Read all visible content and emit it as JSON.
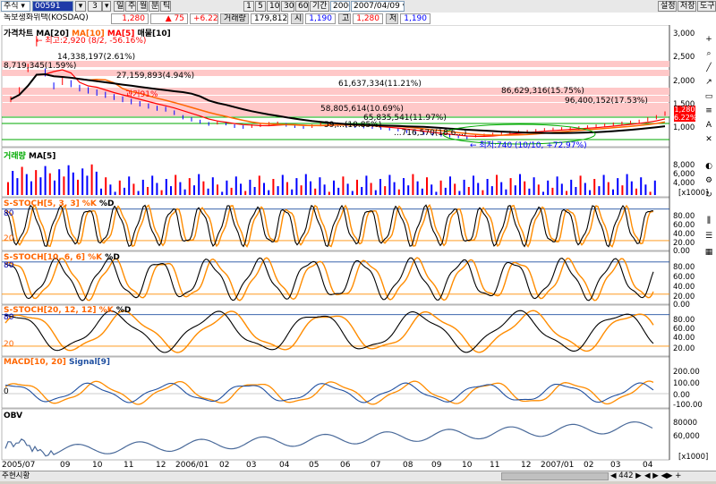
{
  "toolbar": {
    "market": "주식",
    "code": "00591",
    "num": "3",
    "period_tabs": [
      "일",
      "주",
      "월",
      "분",
      "틱"
    ],
    "interval_buttons": [
      "1",
      "5",
      "10",
      "30",
      "60"
    ],
    "period_label": "기간",
    "period_count": "2000",
    "date": "2007/04/09",
    "right_buttons": [
      "설정",
      "저장",
      "도구"
    ]
  },
  "quote": {
    "name": "녹보생화위택(KOSDAQ)",
    "price": "1,280",
    "change_arrow": "▲",
    "change": "75",
    "change_pct": "+6.22",
    "volume_label": "거래량",
    "volume": "179,812",
    "open_label": "시",
    "open": "1,190",
    "high_label": "고",
    "high": "1,280",
    "low_label": "저",
    "low": "1,190"
  },
  "price_panel": {
    "title": "가격차트",
    "ma_legend": [
      "MA[20]",
      "MA[10]",
      "MA[5]",
      "매물[10]"
    ],
    "high_note": "최고:2,920 (8/2, -56.16%)",
    "low_note": "최저:740 (10/10, +72.97%)",
    "percent_note": "과거91%",
    "current_price": "1,280",
    "current_pct": "6.22%",
    "volume_profile": [
      {
        "label": "8,719,345(1.59%)"
      },
      {
        "label": "14,338,197(2.61%)"
      },
      {
        "label": "27,159,893(4.94%)"
      },
      {
        "label": "61,637,334(11.21%)"
      },
      {
        "label": "86,629,316(15.75%)"
      },
      {
        "label": "96,400,152(17.53%)"
      },
      {
        "label": "58,805,614(10.69%)"
      },
      {
        "label": "65,835,541(11.97%)"
      },
      {
        "label": "59,...(10.85%)"
      },
      {
        "label": "...716,570(18.6...)"
      }
    ],
    "y_ticks": [
      "3,000",
      "2,500",
      "2,000",
      "1,500",
      "1,000"
    ],
    "y_range": [
      600,
      3200
    ],
    "close_series": [
      1600,
      1800,
      2300,
      2900,
      2200,
      1900,
      2000,
      1950,
      1850,
      1800,
      1750,
      1700,
      1650,
      1600,
      1550,
      1500,
      1450,
      1400,
      1380,
      1300,
      1200,
      1150,
      1100,
      1050,
      1080,
      1060,
      1000,
      980,
      1000,
      1020,
      1050,
      1060,
      1030,
      1000,
      980,
      1000,
      1040,
      1050,
      1040,
      1020,
      1000,
      990,
      980,
      960,
      940,
      920,
      880,
      860,
      840,
      820,
      800,
      780,
      760,
      740,
      780,
      800,
      820,
      840,
      860,
      870,
      880,
      900,
      920,
      930,
      940,
      950,
      960,
      980,
      1000,
      1020,
      1040,
      1060,
      1080,
      1100,
      1150,
      1200,
      1280
    ]
  },
  "volume_panel": {
    "title": "거래량",
    "ma": "MA[5]",
    "y_ticks": [
      "8,000",
      "6,000",
      "4,000",
      "2,000"
    ],
    "unit": "x1000"
  },
  "stoch1": {
    "title": "S-STOCH[5, 3, 3]",
    "k": "%K",
    "d": "%D",
    "upper": "80",
    "lower": "20",
    "y_ticks": [
      "80.00",
      "60.00",
      "40.00",
      "20.00",
      "0.00"
    ]
  },
  "stoch2": {
    "title": "S-STOCH[10, 6, 6]",
    "k": "%K",
    "d": "%D",
    "upper": "80",
    "lower": "20",
    "y_ticks": [
      "80.00",
      "60.00",
      "40.00",
      "20.00",
      "0.00"
    ]
  },
  "stoch3": {
    "title": "S-STOCH[20, 12, 12]",
    "k": "%K",
    "d": "%D",
    "upper": "80",
    "lower": "20",
    "y_ticks": [
      "80.00",
      "60.00",
      "40.00",
      "20.00"
    ]
  },
  "macd": {
    "title": "MACD[10, 20]",
    "signal": "Signal[9]",
    "zero": "0",
    "y_ticks": [
      "200.00",
      "100.00",
      "0.00",
      "-100.00"
    ]
  },
  "obv": {
    "title": "OBV",
    "y_ticks": [
      "80000",
      "60,000"
    ],
    "unit": "x1000"
  },
  "x_axis": [
    "2005/07",
    "09",
    "10",
    "11",
    "12",
    "2006/01",
    "02",
    "03",
    "04",
    "05",
    "06",
    "07",
    "08",
    "09",
    "10",
    "11",
    "12",
    "2007/01",
    "02",
    "03",
    "04"
  ],
  "status": {
    "left": "주현시황",
    "zoom": "442"
  },
  "colors": {
    "up": "#ff0000",
    "down": "#0000ff",
    "ma20": "#000000",
    "ma10": "#ff6600",
    "ma5": "#ff0000",
    "stoch_k": "#ff8c00",
    "stoch_d": "#000000",
    "volume_profile": "#ffc8c8",
    "obv": "#4a6a9a"
  }
}
